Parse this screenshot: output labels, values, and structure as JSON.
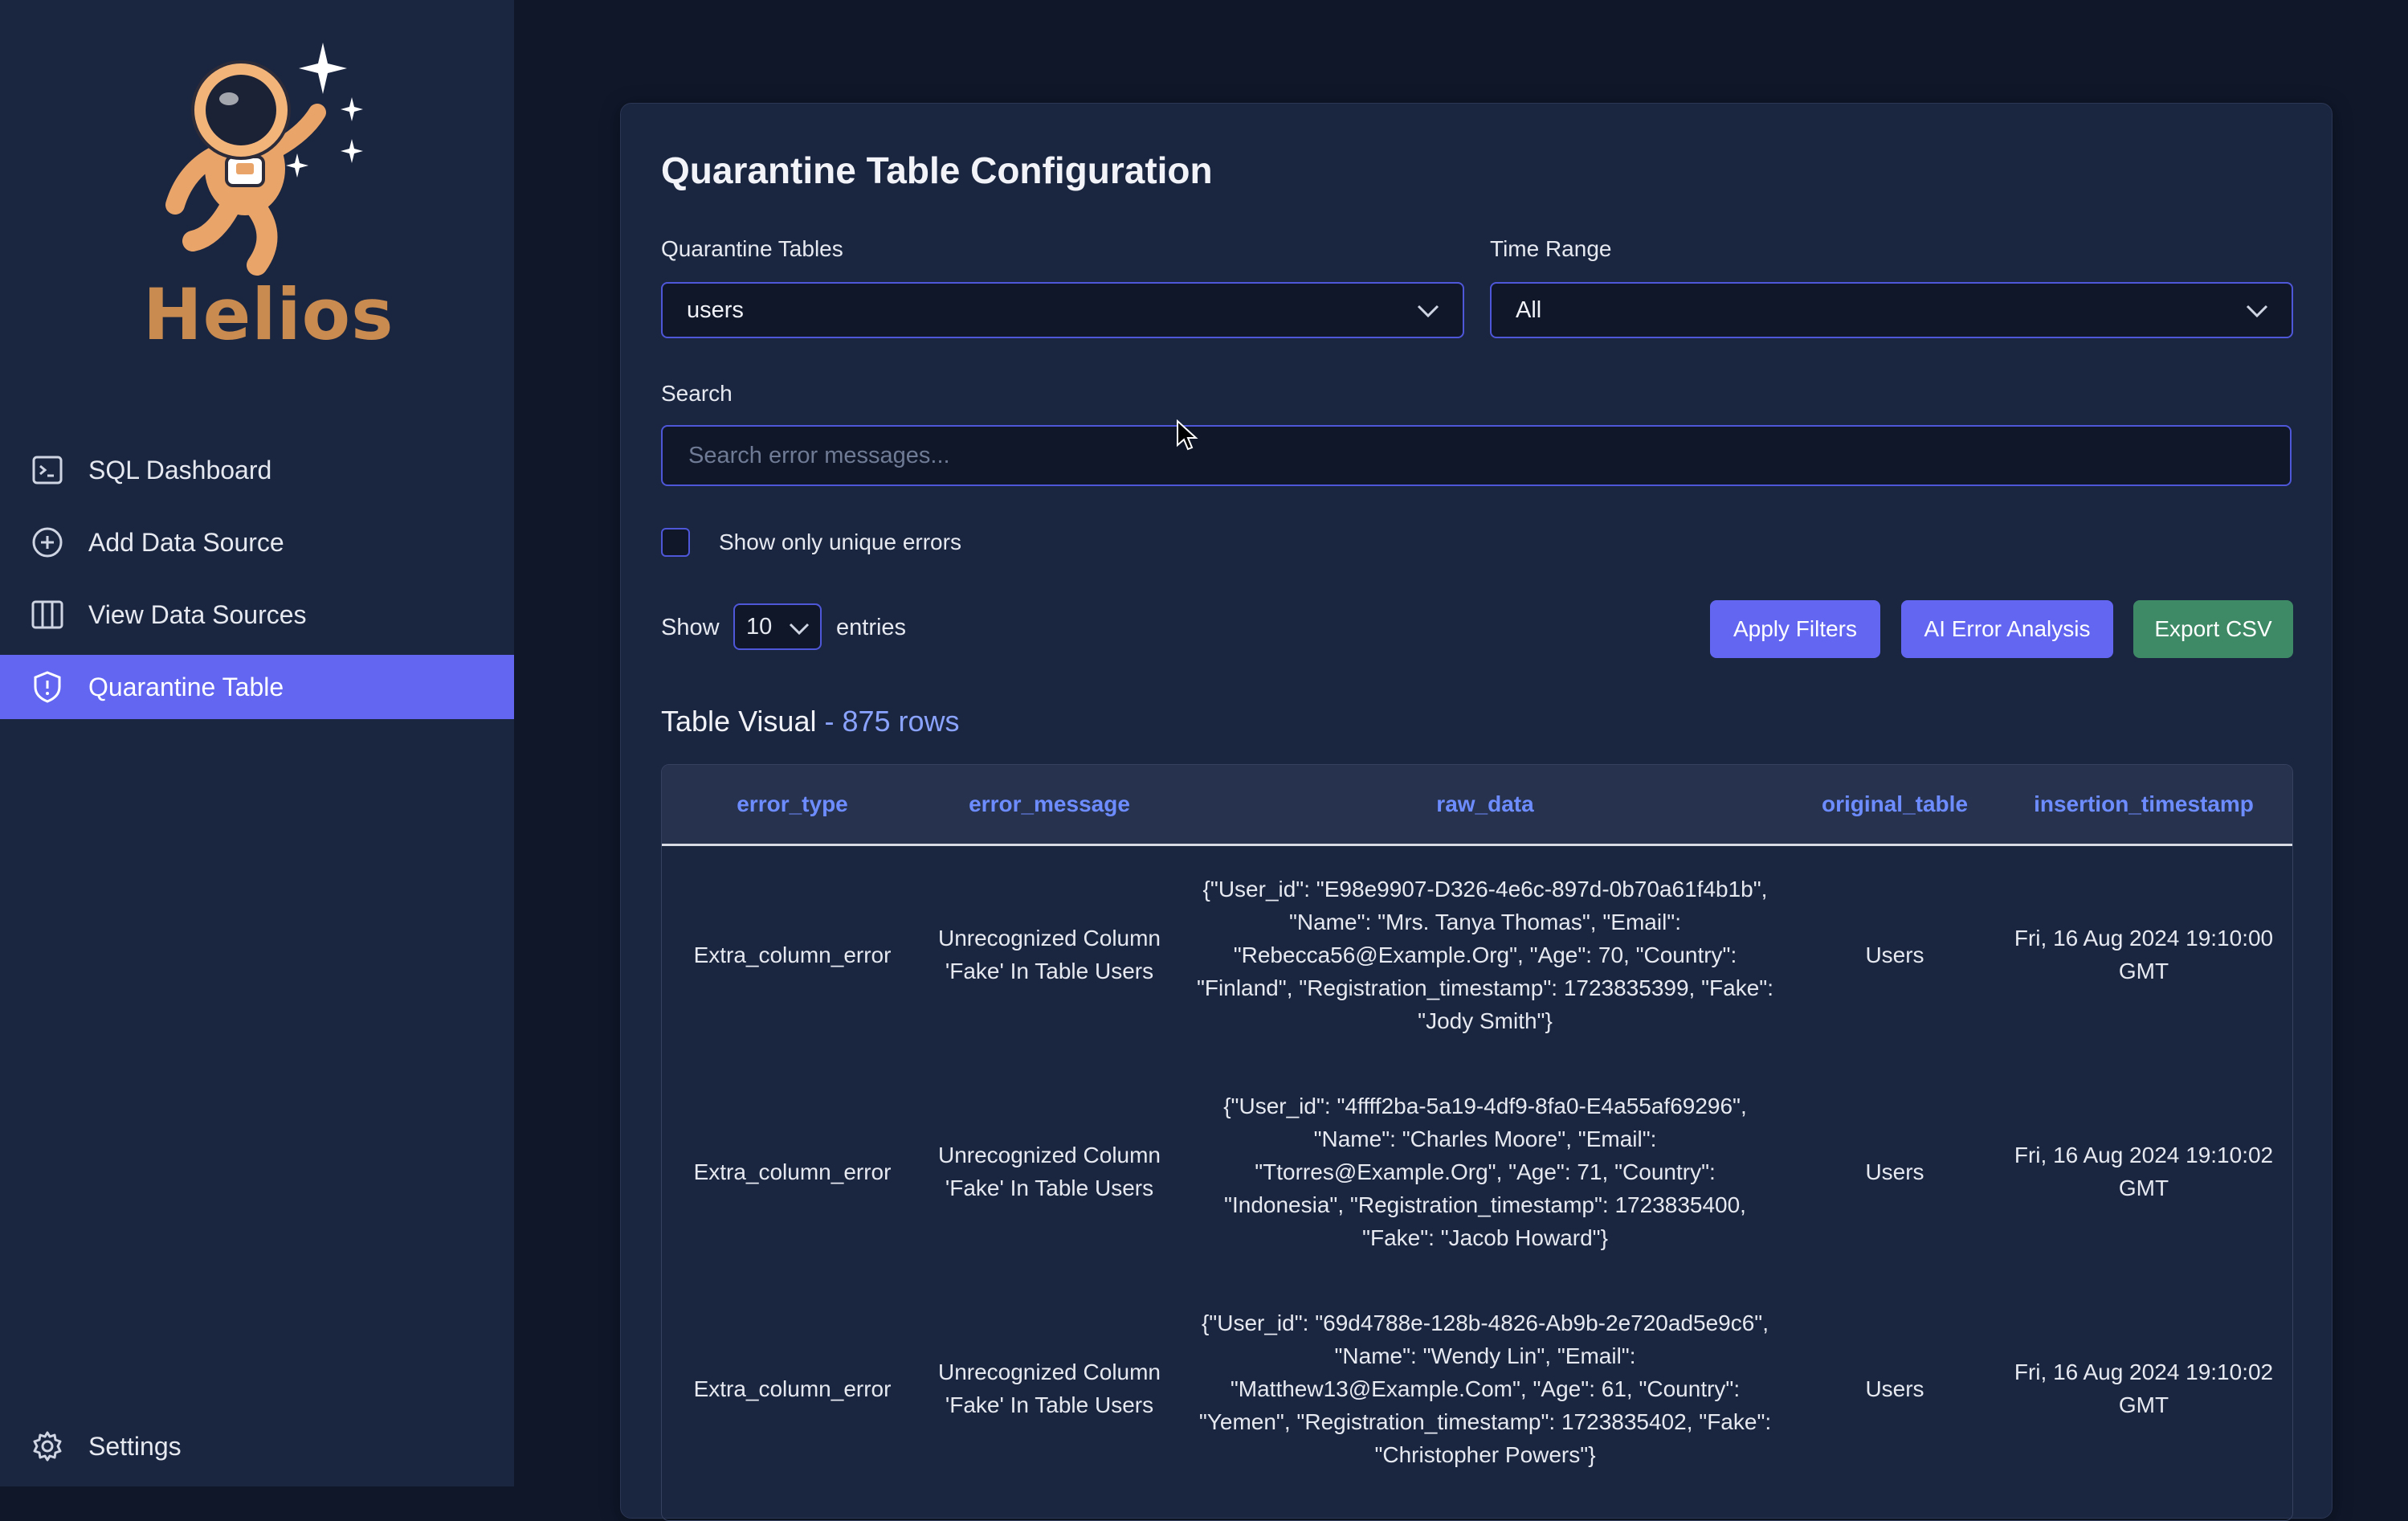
{
  "app": {
    "name": "Helios"
  },
  "sidebar": {
    "items": [
      {
        "label": "SQL Dashboard",
        "icon": "terminal-icon",
        "active": false
      },
      {
        "label": "Add Data Source",
        "icon": "plus-circle-icon",
        "active": false
      },
      {
        "label": "View Data Sources",
        "icon": "columns-icon",
        "active": false
      },
      {
        "label": "Quarantine Table",
        "icon": "shield-icon",
        "active": true
      }
    ],
    "settings_label": "Settings"
  },
  "main": {
    "title": "Quarantine Table Configuration",
    "quarantine_tables_label": "Quarantine Tables",
    "quarantine_tables_value": "users",
    "time_range_label": "Time Range",
    "time_range_value": "All",
    "search_label": "Search",
    "search_placeholder": "Search error messages...",
    "unique_errors_label": "Show only unique errors",
    "show_label": "Show",
    "entries_value": "10",
    "entries_label": "entries",
    "buttons": {
      "apply": "Apply Filters",
      "ai": "AI Error Analysis",
      "export": "Export CSV"
    },
    "table_title": "Table Visual",
    "table_count": " - 875 rows"
  },
  "table": {
    "columns": [
      "error_type",
      "error_message",
      "raw_data",
      "original_table",
      "insertion_timestamp"
    ],
    "rows": [
      {
        "error_type": "Extra_column_error",
        "error_message": "Unrecognized Column 'Fake' In Table Users",
        "raw_data": "{\"User_id\": \"E98e9907-D326-4e6c-897d-0b70a61f4b1b\", \"Name\": \"Mrs. Tanya Thomas\", \"Email\": \"Rebecca56@Example.Org\", \"Age\": 70, \"Country\": \"Finland\", \"Registration_timestamp\": 1723835399, \"Fake\": \"Jody Smith\"}",
        "original_table": "Users",
        "insertion_timestamp": "Fri, 16 Aug 2024 19:10:00 GMT"
      },
      {
        "error_type": "Extra_column_error",
        "error_message": "Unrecognized Column 'Fake' In Table Users",
        "raw_data": "{\"User_id\": \"4ffff2ba-5a19-4df9-8fa0-E4a55af69296\", \"Name\": \"Charles Moore\", \"Email\": \"Ttorres@Example.Org\", \"Age\": 71, \"Country\": \"Indonesia\", \"Registration_timestamp\": 1723835400, \"Fake\": \"Jacob Howard\"}",
        "original_table": "Users",
        "insertion_timestamp": "Fri, 16 Aug 2024 19:10:02 GMT"
      },
      {
        "error_type": "Extra_column_error",
        "error_message": "Unrecognized Column 'Fake' In Table Users",
        "raw_data": "{\"User_id\": \"69d4788e-128b-4826-Ab9b-2e720ad5e9c6\", \"Name\": \"Wendy Lin\", \"Email\": \"Matthew13@Example.Com\", \"Age\": 61, \"Country\": \"Yemen\", \"Registration_timestamp\": 1723835402, \"Fake\": \"Christopher Powers\"}",
        "original_table": "Users",
        "insertion_timestamp": "Fri, 16 Aug 2024 19:10:02 GMT"
      }
    ]
  },
  "colors": {
    "accent": "#6366f1",
    "export": "#3f8a66",
    "brand": "#c98b4f",
    "sidebar_bg": "#1a2540",
    "page_bg": "#0f1729"
  }
}
